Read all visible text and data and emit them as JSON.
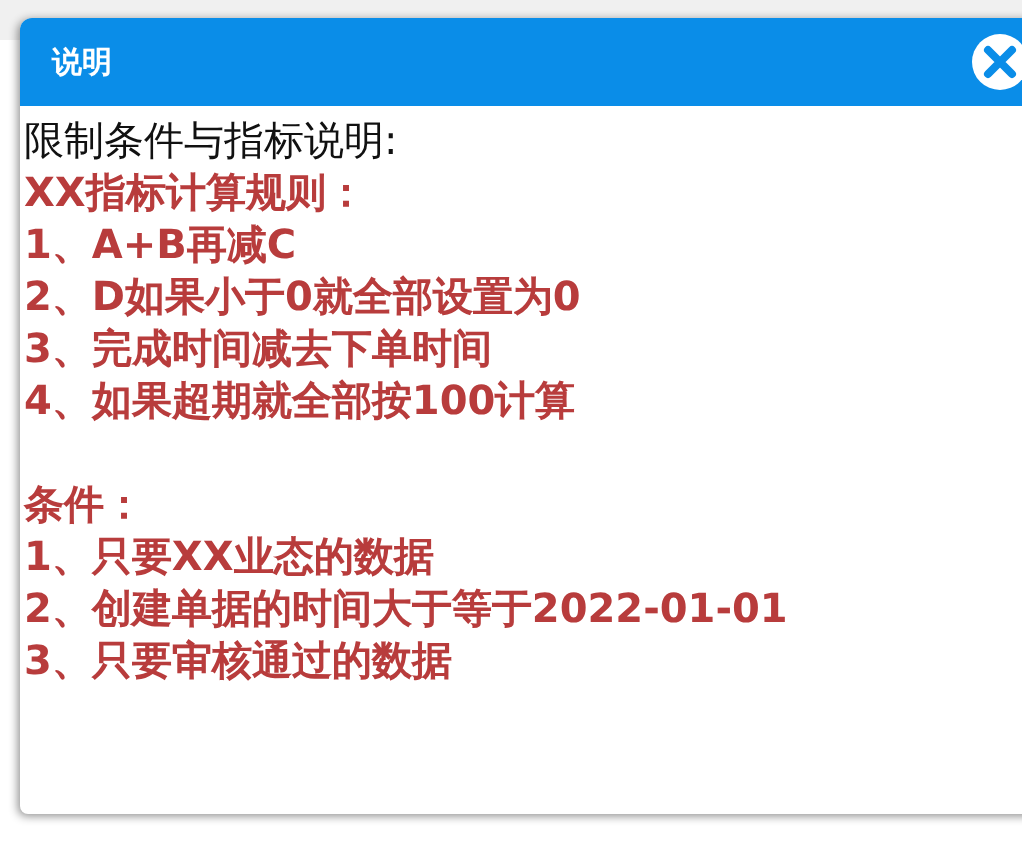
{
  "window": {
    "title": "说明"
  },
  "intro": "限制条件与指标说明:",
  "sections": [
    {
      "heading": "XX指标计算规则：",
      "items": [
        "1、A+B再减C",
        "2、D如果小于0就全部设置为0",
        "3、完成时间减去下单时间",
        "4、如果超期就全部按100计算"
      ]
    },
    {
      "heading": "条件：",
      "items": [
        "1、只要XX业态的数据",
        "2、创建单据的时间大于等于2022-01-01",
        "3、只要审核通过的数据"
      ]
    }
  ]
}
